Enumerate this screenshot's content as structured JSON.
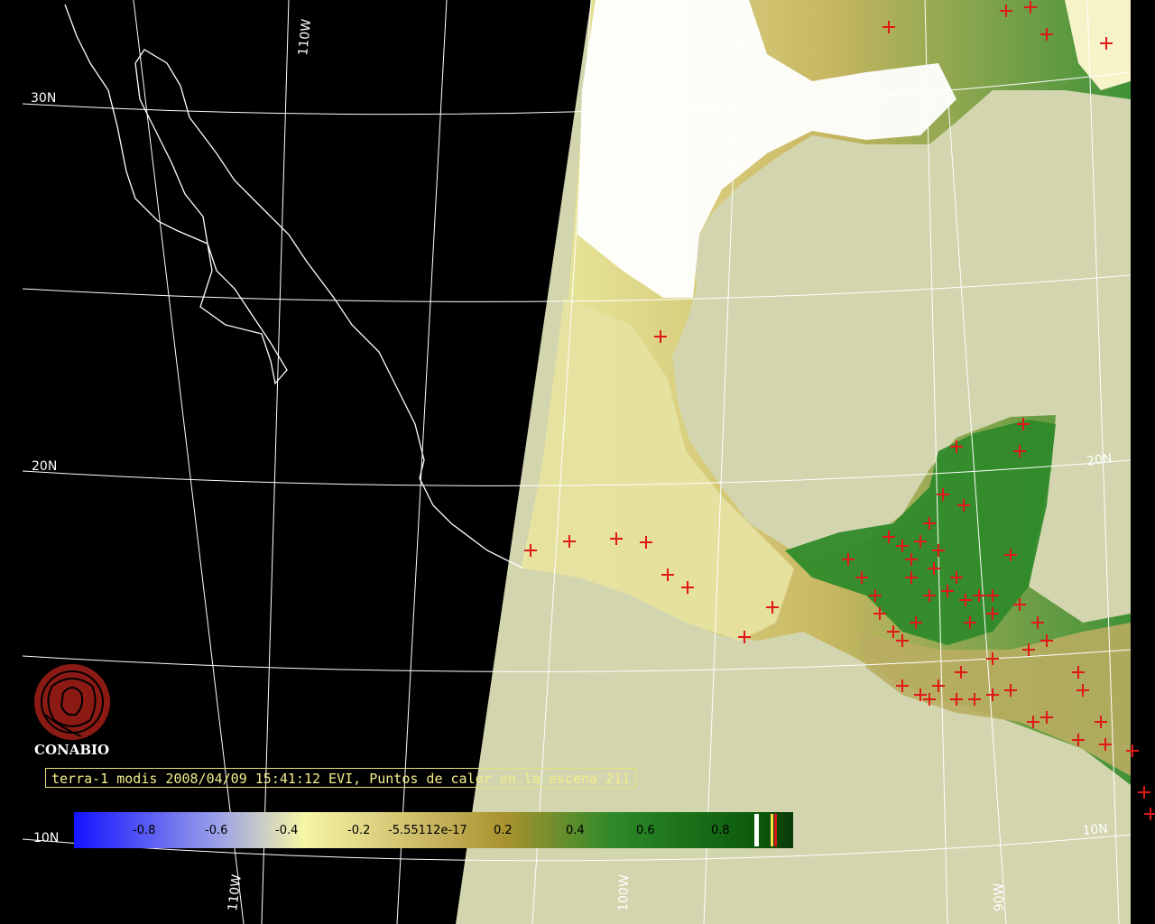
{
  "caption": "terra-1 modis 2008/04/09 15:41:12 EVI, Puntos de calor en la escena 211",
  "logo": {
    "text": "CONABIO",
    "icon": "conabio-seal-icon",
    "color": "#8c1a14"
  },
  "grid_labels": {
    "lat_30n": "30N",
    "lat_20n_left": "20N",
    "lat_20n_right": "20N",
    "lat_10n_left": "10N",
    "lat_10n_right": "10N",
    "lon_110w_top": "110W",
    "lon_110w_bottom": "110W",
    "lon_100w": "100W",
    "lon_90w": "90W"
  },
  "colorbar": {
    "ticks": [
      "-0.8",
      "-0.6",
      "-0.4",
      "-0.2",
      "-5.55112e-17",
      "0.2",
      "0.4",
      "0.6",
      "0.8"
    ],
    "colors": {
      "low": "#1a1aff",
      "mid_low": "#f5f59a",
      "mid": "#a8902e",
      "high": "#0f6d0f",
      "end": "#0a3a0a"
    }
  },
  "colors": {
    "night": "#000000",
    "water": "#d2d5ae",
    "cloud": "#ffffff",
    "hotspot": "#e01818",
    "grid": "#ffffff"
  }
}
